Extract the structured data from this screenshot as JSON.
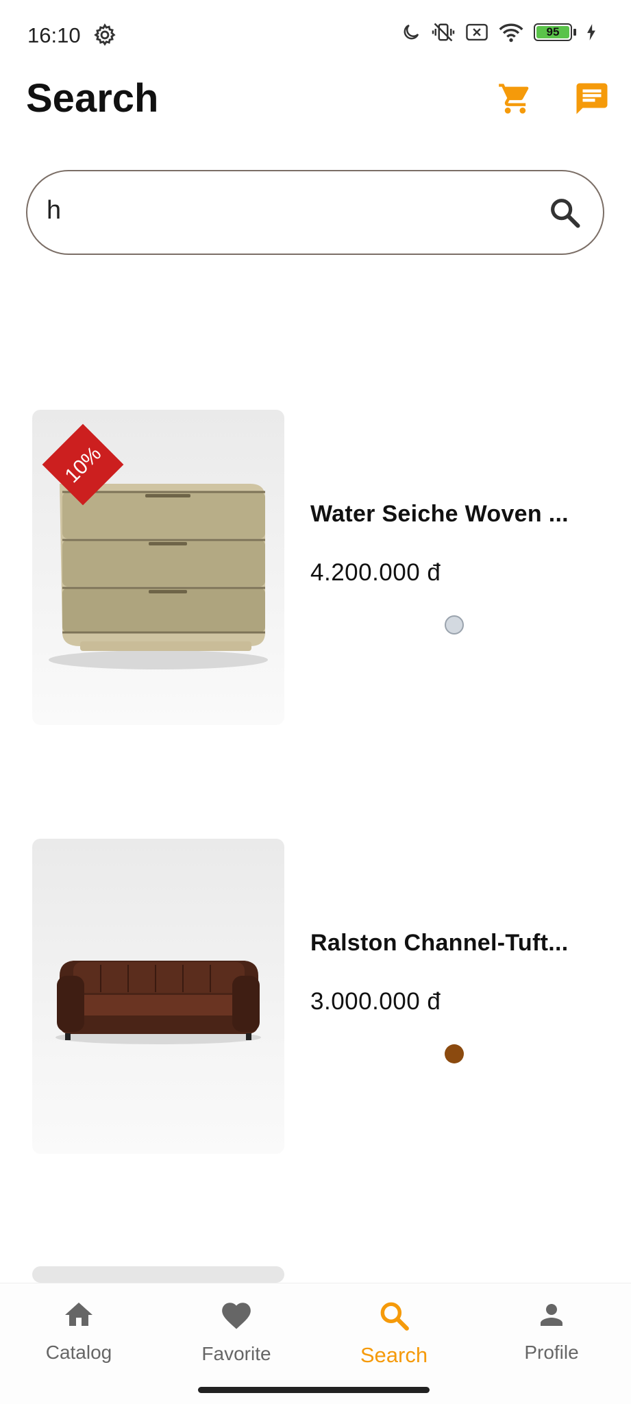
{
  "status_bar": {
    "time": "16:10",
    "battery": "95"
  },
  "header": {
    "title": "Search"
  },
  "search": {
    "value": "h"
  },
  "products": [
    {
      "name": "Water Seiche Woven ...",
      "price": "4.200.000 đ",
      "discount": "10%",
      "color": "#d3d9e0"
    },
    {
      "name": "Ralston Channel-Tuft...",
      "price": "3.000.000 đ",
      "color": "#8b4a0f"
    }
  ],
  "nav": {
    "items": [
      {
        "label": "Catalog",
        "icon": "home-icon"
      },
      {
        "label": "Favorite",
        "icon": "heart-icon"
      },
      {
        "label": "Search",
        "icon": "search-icon",
        "active": true
      },
      {
        "label": "Profile",
        "icon": "person-icon"
      }
    ]
  },
  "colors": {
    "accent": "#f59a0a",
    "discount": "#cc1f1f"
  }
}
